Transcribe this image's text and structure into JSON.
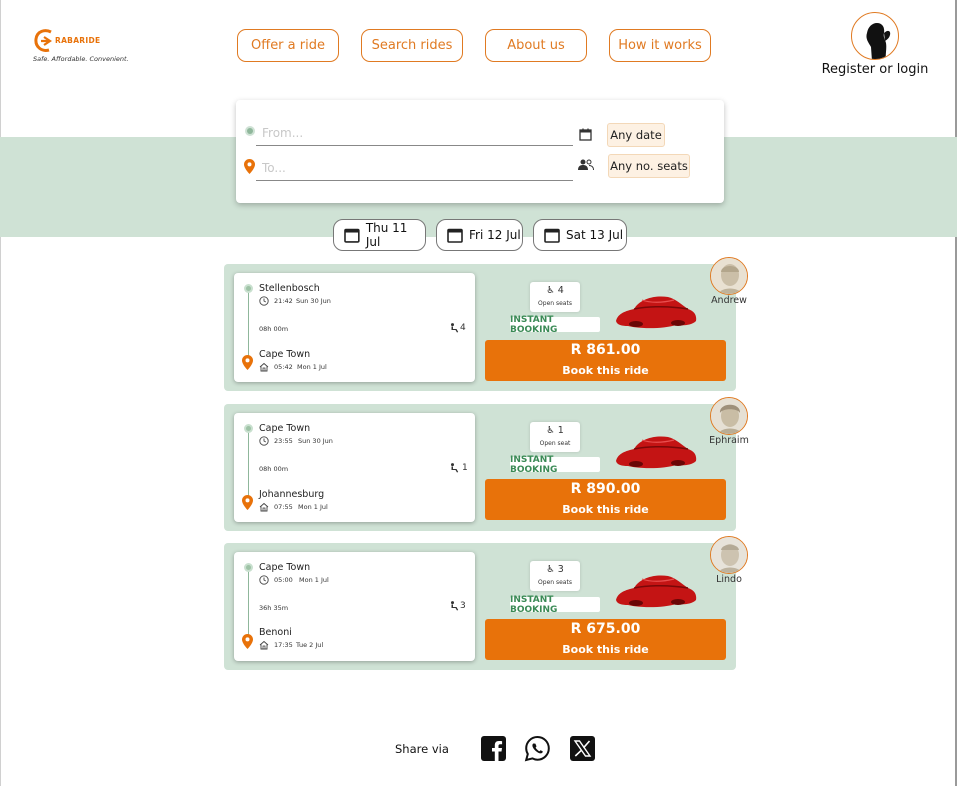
{
  "brand": {
    "name": "RABARIDE",
    "tagline": "Safe. Affordable. Convenient.",
    "accent": "#e8720a",
    "green": "#cfe2d5"
  },
  "nav": [
    "Offer a ride",
    "Search rides",
    "About us",
    "How it works"
  ],
  "account": {
    "label": "Register or login"
  },
  "search": {
    "from_placeholder": "From...",
    "to_placeholder": "To...",
    "date_label": "Any date",
    "seats_label": "Any no. seats"
  },
  "dates": [
    "Thu 11 Jul",
    "Fri 12 Jul",
    "Sat 13 Jul"
  ],
  "rides": [
    {
      "from": "Stellenbosch",
      "depart_time": "21:42",
      "depart_date": "Sun 30 Jun",
      "duration": "08h 00m",
      "seats": "4",
      "to": "Cape Town",
      "arrive_time": "05:42",
      "arrive_date": "Mon 1 Jul",
      "seat_label": "Open seats",
      "badge": "INSTANT BOOKING",
      "price": "R 861.00",
      "book_label": "Book this ride",
      "driver": "Andrew"
    },
    {
      "from": "Cape Town",
      "depart_time": "23:55",
      "depart_date": "Sun 30 Jun",
      "duration": "08h 00m",
      "seats": "1",
      "to": "Johannesburg",
      "arrive_time": "07:55",
      "arrive_date": "Mon 1 Jul",
      "seat_label": "Open seat",
      "badge": "INSTANT BOOKING",
      "price": "R 890.00",
      "book_label": "Book this ride",
      "driver": "Ephraim"
    },
    {
      "from": "Cape Town",
      "depart_time": "05:00",
      "depart_date": "Mon 1 Jul",
      "duration": "36h 35m",
      "seats": "3",
      "to": "Benoni",
      "arrive_time": "17:35",
      "arrive_date": "Tue 2 Jul",
      "seat_label": "Open seats",
      "badge": "INSTANT BOOKING",
      "price": "R 675.00",
      "book_label": "Book this ride",
      "driver": "Lindo"
    }
  ],
  "share": {
    "label": "Share via",
    "icons": [
      "facebook-icon",
      "whatsapp-icon",
      "x-icon"
    ]
  }
}
